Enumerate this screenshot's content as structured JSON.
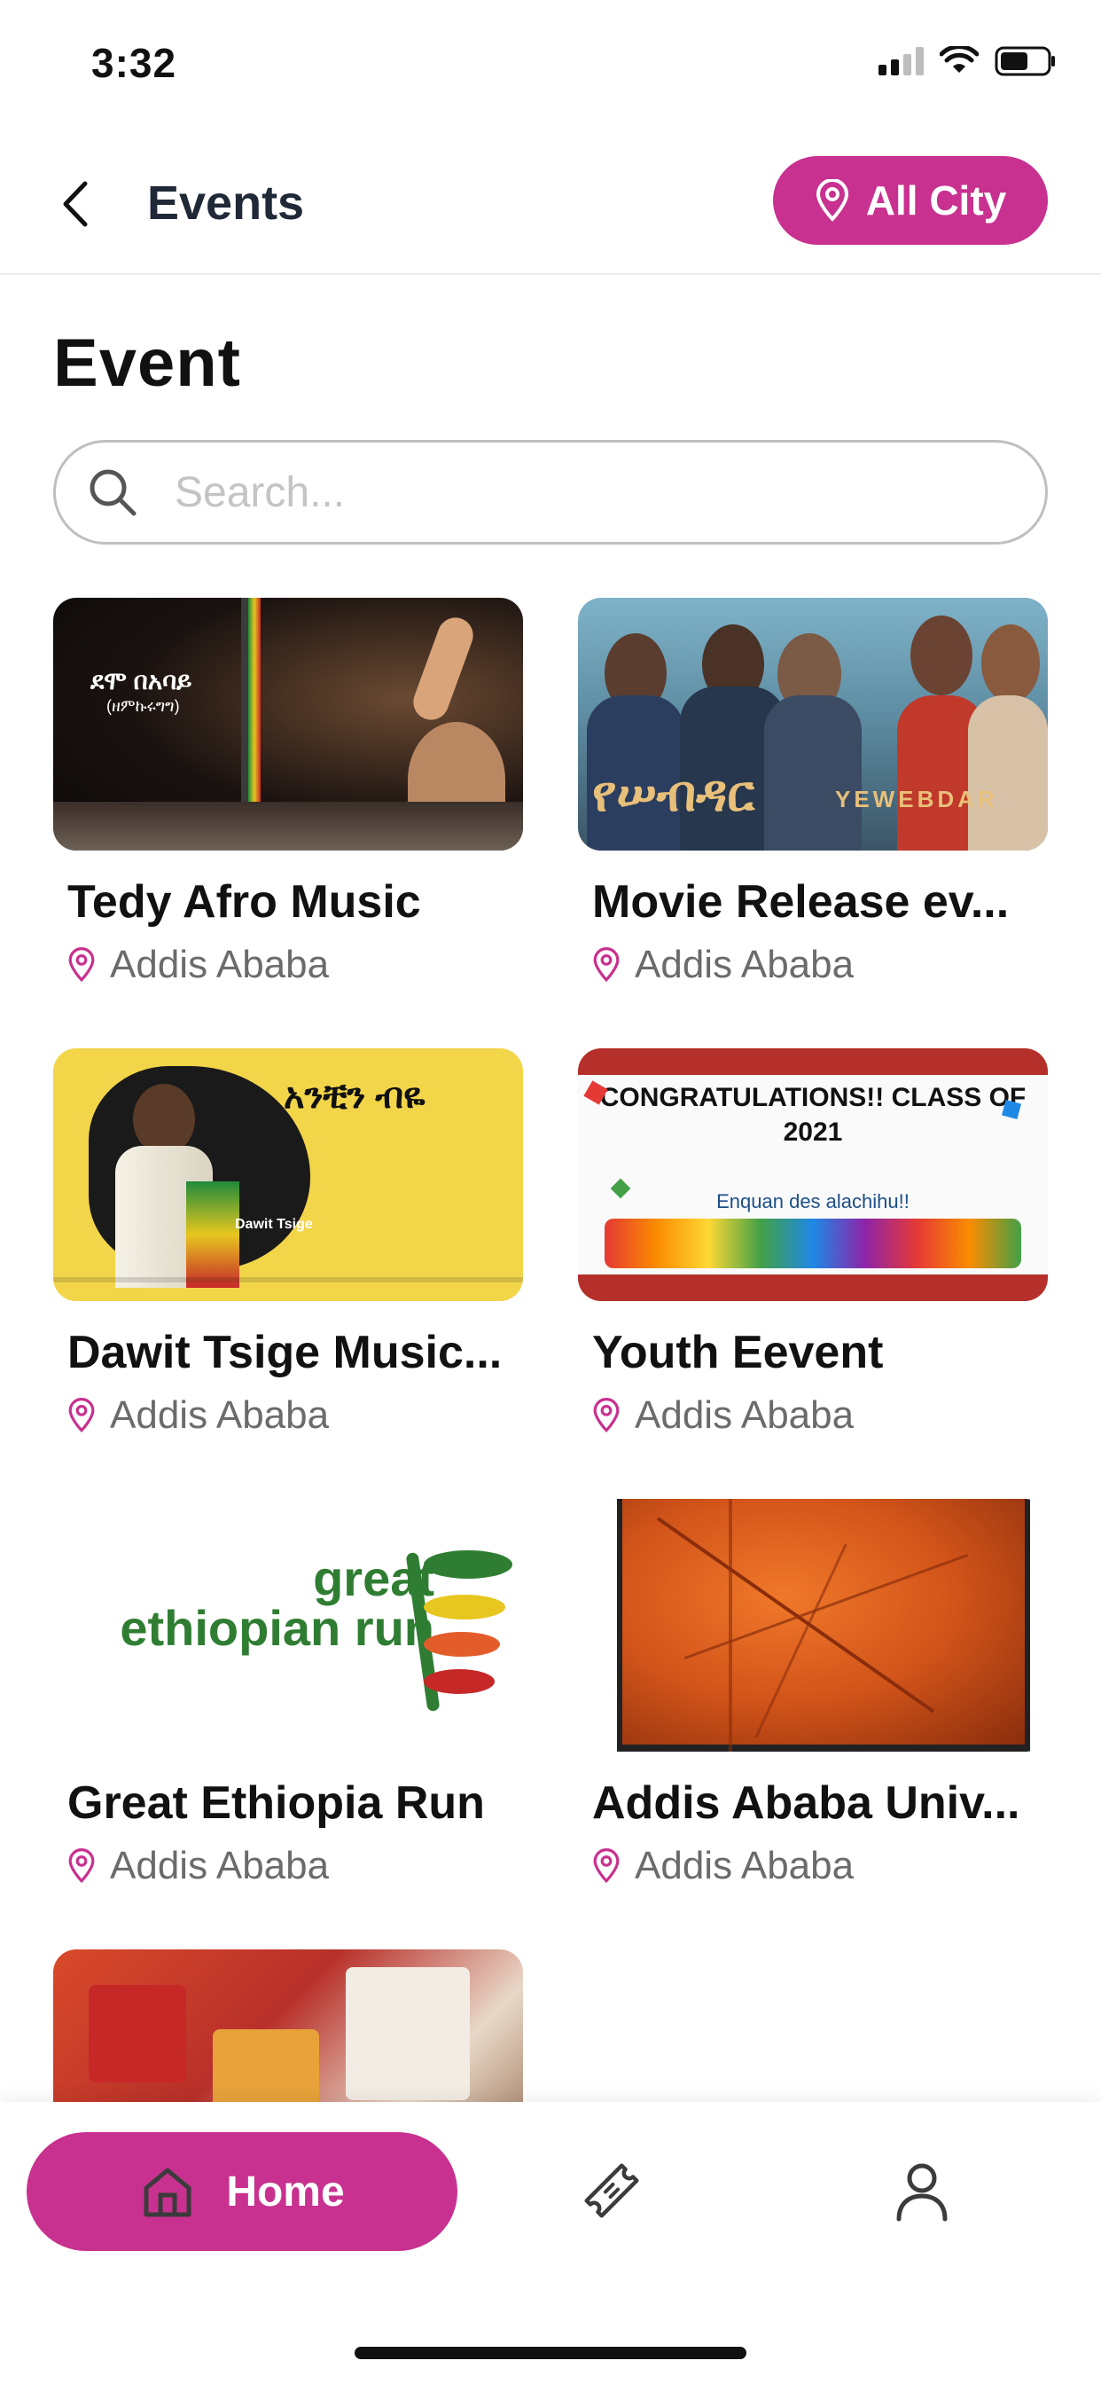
{
  "status_bar": {
    "time": "3:32"
  },
  "header": {
    "title": "Events",
    "city_button": "All City"
  },
  "page": {
    "title": "Event"
  },
  "search": {
    "placeholder": "Search..."
  },
  "events": [
    {
      "title": "Tedy Afro Music",
      "location": "Addis Ababa",
      "image_text": "ደሞ በአባይ",
      "image_subtext": "(ዘምኩሩግግ)"
    },
    {
      "title": "Movie Release ev...",
      "location": "Addis Ababa",
      "image_text": "የሠብዳር",
      "image_subtext": "YEWEBDAR"
    },
    {
      "title": "Dawit Tsige Music...",
      "location": "Addis Ababa",
      "image_text": "አንቺን ብዬ",
      "image_subtext": "Dawit Tsige"
    },
    {
      "title": "Youth Eevent",
      "location": "Addis Ababa",
      "image_text": "CONGRATULATIONS!! CLASS OF 2021",
      "image_subtext": "Enquan des alachihu!!"
    },
    {
      "title": "Great Ethiopia Run",
      "location": "Addis Ababa",
      "image_text": "great ethiopian run"
    },
    {
      "title": "Addis Ababa Univ...",
      "location": "Addis Ababa"
    },
    {
      "title": "",
      "location": ""
    }
  ],
  "bottom_nav": {
    "home_label": "Home"
  },
  "colors": {
    "accent": "#c8318f",
    "text": "#111111",
    "muted": "#6b6b6b"
  }
}
